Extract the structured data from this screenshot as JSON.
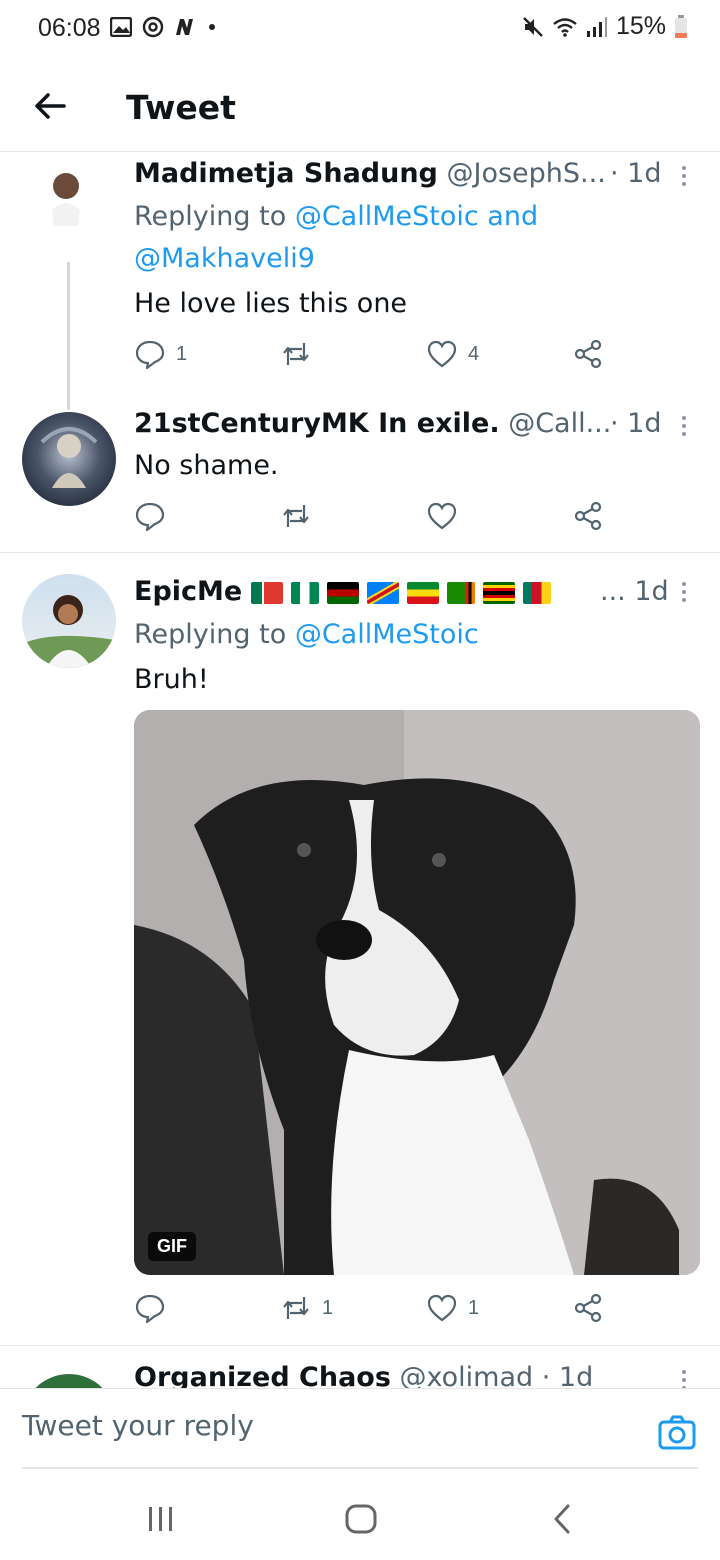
{
  "status_bar": {
    "time": "06:08",
    "battery": "15%"
  },
  "header": {
    "title": "Tweet"
  },
  "tweets": [
    {
      "name": "Madimetja Shadung",
      "handle": "@JosephS...",
      "time": "· 1d",
      "replying_prefix": "Replying to",
      "replying_to_1": "@CallMeStoic and",
      "replying_to_2": "@Makhaveli9",
      "text": "He love lies this one",
      "reply_count": "1",
      "retweet_count": "",
      "like_count": "4"
    },
    {
      "name": "21stCenturyMK In exile.",
      "handle": "@Call...",
      "time": "· 1d",
      "text": "No shame.",
      "reply_count": "",
      "retweet_count": "",
      "like_count": ""
    },
    {
      "name": "EpicMe",
      "time": "... 1d",
      "replying_prefix": "Replying to",
      "replying_to_1": "@CallMeStoic",
      "text": "Bruh!",
      "media_badge": "GIF",
      "reply_count": "",
      "retweet_count": "1",
      "like_count": "1"
    },
    {
      "name": "Organized Chaos",
      "handle": "@xolimad",
      "time": "· 1d"
    }
  ],
  "reply_bar": {
    "placeholder": "Tweet your reply"
  },
  "colors": {
    "link": "#1d9bf0",
    "secondary": "#536471",
    "divider": "#e6e6e6"
  }
}
